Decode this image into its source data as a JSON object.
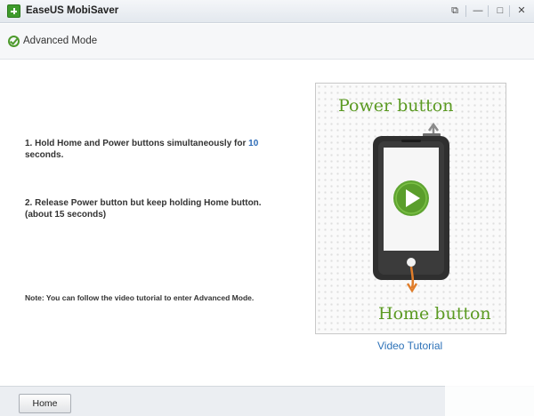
{
  "window": {
    "title": "EaseUS MobiSaver",
    "controls": {
      "feedback": "⧉",
      "minimize": "—",
      "maximize": "□",
      "close": "✕"
    }
  },
  "mode_bar": {
    "title": "Advanced Mode"
  },
  "steps": {
    "step1_before": "1. Hold Home and Power buttons simultaneously for ",
    "step1_highlight": "10",
    "step1_after": " seconds.",
    "step2": "2. Release Power button but keep holding Home button. (about 15 seconds)"
  },
  "note": "Note: You can follow the video tutorial to enter Advanced Mode.",
  "tutorial": {
    "power_label": "Power button",
    "home_label": "Home button",
    "link_text": "Video Tutorial"
  },
  "bottom": {
    "home_button": "Home"
  },
  "colors": {
    "accent_green": "#5b9a22",
    "link_blue": "#2d72b8"
  },
  "icons": [
    "app-logo-icon",
    "feedback-icon",
    "minimize-icon",
    "maximize-icon",
    "close-icon",
    "check-circle-icon",
    "play-icon"
  ]
}
